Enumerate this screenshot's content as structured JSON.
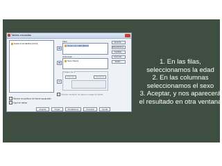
{
  "dialog": {
    "title": "Tablas cruzadas",
    "source_list": {
      "items": [
        "Hasta la tentabilica [CCH]"
      ]
    },
    "filas_label": "Filas:",
    "filas_items": [
      "Grupo por edad [Edad]"
    ],
    "columnas_label": "Columnas:",
    "columnas_items": [
      "Sexo [Sexo]"
    ],
    "capa_label": "Capa 1 de 1",
    "capa_prev": "Anterior",
    "capa_next": "Siguiente",
    "capa_option": "Mostrar variables de capa en capas de tablas",
    "side_buttons": [
      "Exacta...",
      "Estadísticos...",
      "Casillas...",
      "Formato...",
      "Estilo..."
    ],
    "checkboxes": [
      "Mostrar los gráficos de barras agrupadas",
      "Suprimir tablas"
    ],
    "bottom_buttons": [
      "Aceptar",
      "Pegar",
      "Restablecer",
      "Cancelar",
      "Ayuda"
    ]
  },
  "steps": [
    "1.   En las filas, seleccionamos la edad",
    "2.   En las columnas seleccionamos el sexo",
    "3.   Aceptar, y nos aparecerá el resultado en otra ventana"
  ],
  "colors": {
    "board": "#3e4f42",
    "dialog_bg": "#eef1f6",
    "text_on_board": "#ffffff"
  }
}
